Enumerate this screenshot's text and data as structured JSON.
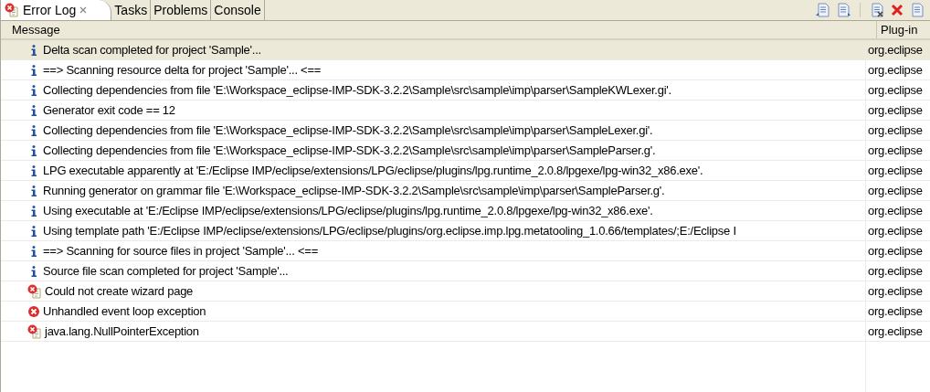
{
  "tabs": [
    {
      "label": "Error Log",
      "selected": true,
      "closable": true
    },
    {
      "label": "Tasks",
      "selected": false
    },
    {
      "label": "Problems",
      "selected": false
    },
    {
      "label": "Console",
      "selected": false
    }
  ],
  "table": {
    "columns": [
      "Message",
      "Plug-in"
    ],
    "rows": [
      {
        "kind": "info",
        "selected": true,
        "message": "Delta scan completed for project 'Sample'...",
        "plugin": "org.eclipse"
      },
      {
        "kind": "info",
        "selected": false,
        "message": "==> Scanning resource delta for project 'Sample'... <==",
        "plugin": "org.eclipse"
      },
      {
        "kind": "info",
        "selected": false,
        "message": "Collecting dependencies from file 'E:\\Workspace_eclipse-IMP-SDK-3.2.2\\Sample\\src\\sample\\imp\\parser\\SampleKWLexer.gi'.",
        "plugin": "org.eclipse"
      },
      {
        "kind": "info",
        "selected": false,
        "message": "Generator exit code == 12",
        "plugin": "org.eclipse"
      },
      {
        "kind": "info",
        "selected": false,
        "message": "Collecting dependencies from file 'E:\\Workspace_eclipse-IMP-SDK-3.2.2\\Sample\\src\\sample\\imp\\parser\\SampleLexer.gi'.",
        "plugin": "org.eclipse"
      },
      {
        "kind": "info",
        "selected": false,
        "message": "Collecting dependencies from file 'E:\\Workspace_eclipse-IMP-SDK-3.2.2\\Sample\\src\\sample\\imp\\parser\\SampleParser.g'.",
        "plugin": "org.eclipse"
      },
      {
        "kind": "info",
        "selected": false,
        "message": "LPG executable apparently at 'E:/Eclipse IMP/eclipse/extensions/LPG/eclipse/plugins/lpg.runtime_2.0.8/lpgexe/lpg-win32_x86.exe'.",
        "plugin": "org.eclipse"
      },
      {
        "kind": "info",
        "selected": false,
        "message": "Running generator on grammar file 'E:\\Workspace_eclipse-IMP-SDK-3.2.2\\Sample\\src\\sample\\imp\\parser\\SampleParser.g'.",
        "plugin": "org.eclipse"
      },
      {
        "kind": "info",
        "selected": false,
        "message": "Using executable at 'E:/Eclipse IMP/eclipse/extensions/LPG/eclipse/plugins/lpg.runtime_2.0.8/lpgexe/lpg-win32_x86.exe'.",
        "plugin": "org.eclipse"
      },
      {
        "kind": "info",
        "selected": false,
        "message": "Using template path 'E:/Eclipse IMP/eclipse/extensions/LPG/eclipse/plugins/org.eclipse.imp.lpg.metatooling_1.0.66/templates/;E:/Eclipse I",
        "plugin": "org.eclipse"
      },
      {
        "kind": "info",
        "selected": false,
        "message": "==> Scanning for source files in project 'Sample'... <==",
        "plugin": "org.eclipse"
      },
      {
        "kind": "info",
        "selected": false,
        "message": "Source file scan completed for project 'Sample'...",
        "plugin": "org.eclipse"
      },
      {
        "kind": "error_entry",
        "selected": false,
        "message": "Could not create wizard page",
        "plugin": "org.eclipse"
      },
      {
        "kind": "error",
        "selected": false,
        "message": "Unhandled event loop exception",
        "plugin": "org.eclipse"
      },
      {
        "kind": "error_entry",
        "selected": false,
        "message": "java.lang.NullPointerException",
        "plugin": "org.eclipse"
      }
    ]
  }
}
